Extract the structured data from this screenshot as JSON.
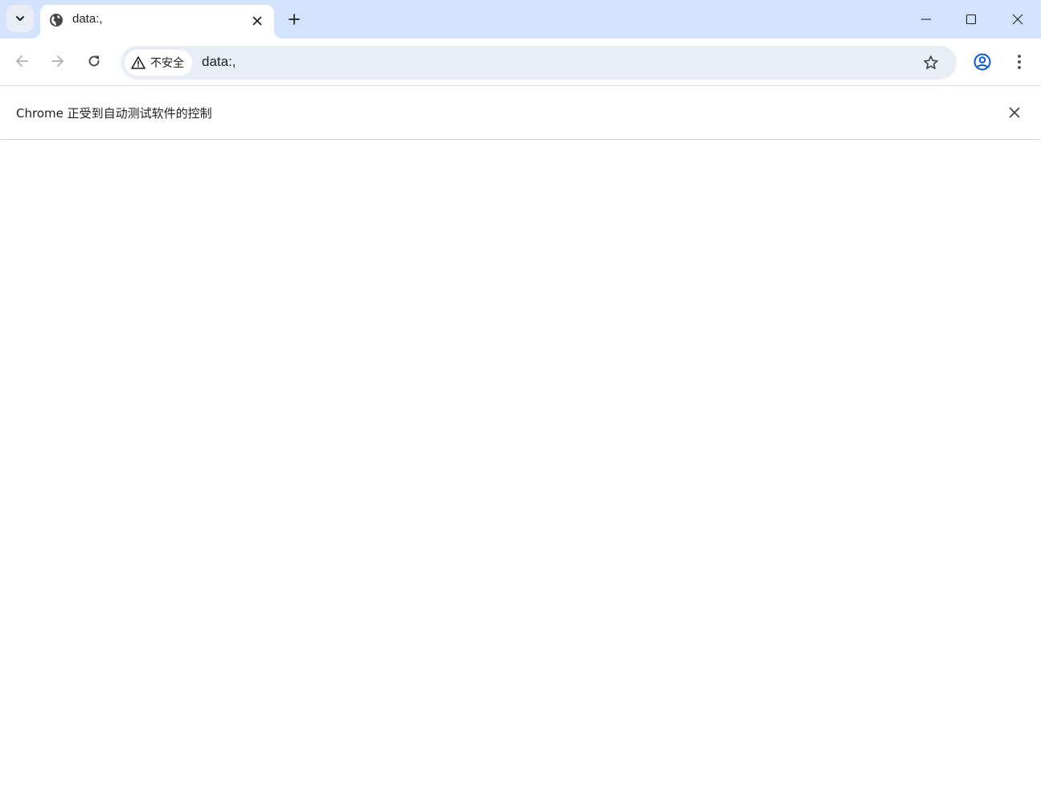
{
  "colors": {
    "tabstrip_bg": "#d3e3fd",
    "omnibox_bg": "#e9eef6",
    "icon": "#474747",
    "profile_accent": "#0b57d0"
  },
  "tabs": [
    {
      "title": "data:,",
      "favicon": "globe-icon",
      "active": true
    }
  ],
  "toolbar": {
    "security_label": "不安全",
    "url": "data:,"
  },
  "infobar": {
    "message": "Chrome 正受到自动测试软件的控制"
  }
}
